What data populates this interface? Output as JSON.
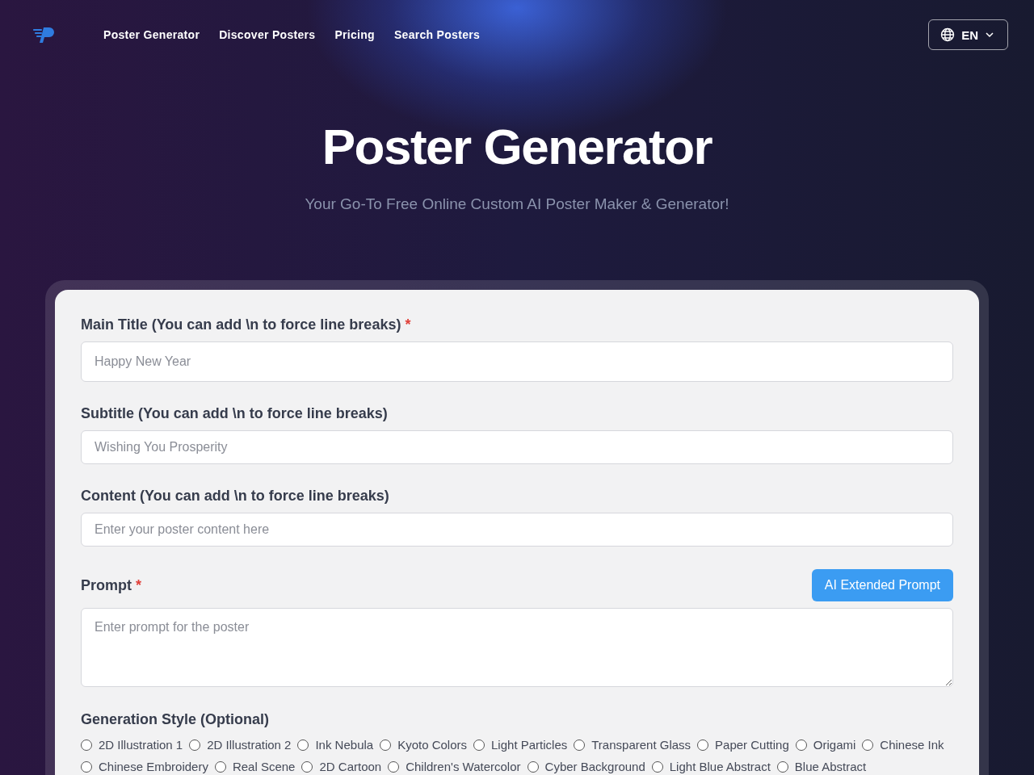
{
  "nav": {
    "links": [
      "Poster Generator",
      "Discover Posters",
      "Pricing",
      "Search Posters"
    ],
    "language": "EN"
  },
  "hero": {
    "title": "Poster Generator",
    "subtitle": "Your Go-To Free Online Custom AI Poster Maker & Generator!"
  },
  "form": {
    "fields": [
      {
        "kind": "input",
        "label": "Main Title (You can add \\n to force line breaks)",
        "marker": "*",
        "placeholder": "Happy New Year"
      },
      {
        "kind": "input",
        "label": "Subtitle (You can add \\n to force line breaks)",
        "placeholder": "Wishing You Prosperity"
      },
      {
        "kind": "input",
        "label": "Content (You can add \\n to force line breaks)",
        "placeholder": "Enter your poster content here"
      },
      {
        "kind": "textarea",
        "label": "Prompt",
        "marker": "*",
        "placeholder": "Enter prompt for the poster",
        "action": "AI Extended Prompt"
      }
    ],
    "style_section": {
      "label": "Generation Style (Optional)",
      "options": [
        {
          "label": "2D Illustration 1",
          "selected": false
        },
        {
          "label": "2D Illustration 2",
          "selected": false
        },
        {
          "label": "Ink Nebula",
          "selected": false
        },
        {
          "label": "Kyoto Colors",
          "selected": false
        },
        {
          "label": "Light Particles",
          "selected": false
        },
        {
          "label": "Transparent Glass",
          "selected": false
        },
        {
          "label": "Paper Cutting",
          "selected": false
        },
        {
          "label": "Origami",
          "selected": false
        },
        {
          "label": "Chinese Ink",
          "selected": false
        },
        {
          "label": "Chinese Embroidery",
          "selected": false
        },
        {
          "label": "Real Scene",
          "selected": false
        },
        {
          "label": "2D Cartoon",
          "selected": false
        },
        {
          "label": "Children's Watercolor",
          "selected": false
        },
        {
          "label": "Cyber Background",
          "selected": false
        },
        {
          "label": "Light Blue Abstract",
          "selected": false
        },
        {
          "label": "Blue Abstract",
          "selected": false
        }
      ]
    }
  }
}
